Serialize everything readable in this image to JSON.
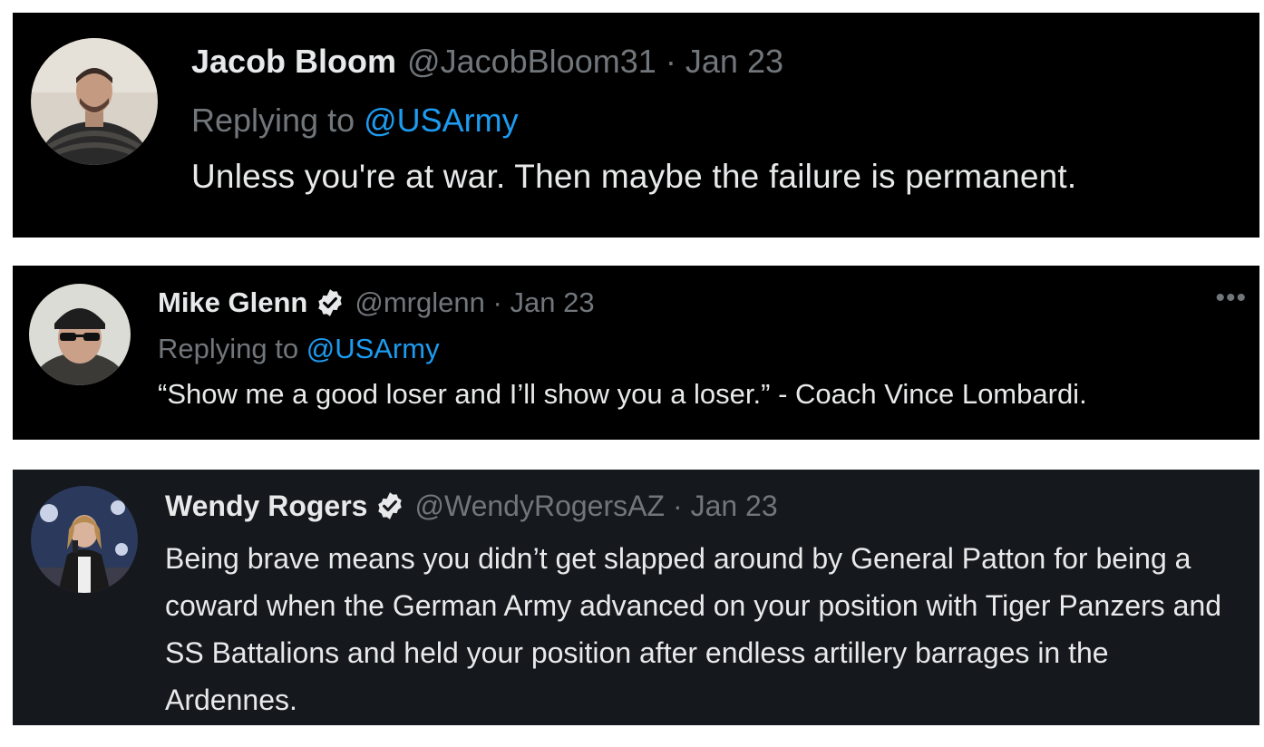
{
  "tweets": [
    {
      "name": "Jacob Bloom",
      "handle": "@JacobBloom31",
      "separator": "·",
      "date": "Jan 23",
      "replying_prefix": "Replying to ",
      "replying_to": "@USArmy",
      "text": "Unless you're at war.  Then maybe the failure is permanent."
    },
    {
      "name": "Mike Glenn",
      "verified": true,
      "handle": "@mrglenn",
      "separator": "·",
      "date": "Jan 23",
      "replying_prefix": "Replying to ",
      "replying_to": "@USArmy",
      "text": "“Show me a good loser and I’ll show you a loser.” - Coach Vince Lombardi.",
      "more_icon": "more-horizontal-icon"
    },
    {
      "name": "Wendy Rogers",
      "verified": true,
      "handle": "@WendyRogersAZ",
      "separator": "·",
      "date": "Jan 23",
      "text": "Being brave means you didn’t get slapped around by General Patton for being a coward when the German Army advanced on your position with Tiger Panzers and SS Battalions and held your position after endless artillery barrages in the Ardennes."
    }
  ],
  "colors": {
    "background": "#000000",
    "text_primary": "#e7e9ea",
    "text_secondary": "#71767b",
    "link": "#1d9bf0"
  }
}
